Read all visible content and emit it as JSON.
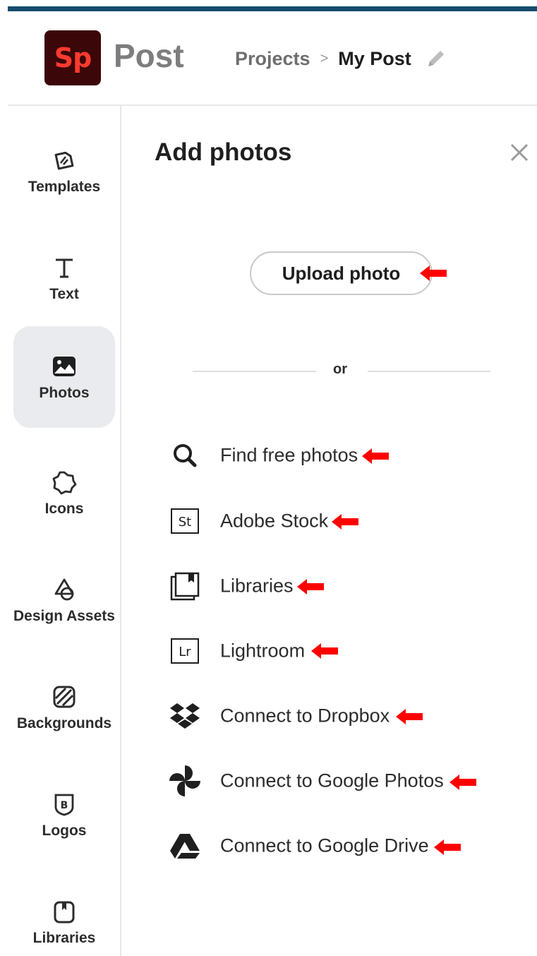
{
  "app": {
    "logo_text": "Sp",
    "name": "Post"
  },
  "breadcrumb": {
    "parent": "Projects",
    "separator": ">",
    "current": "My Post"
  },
  "sidebar": {
    "items": [
      {
        "label": "Templates",
        "icon": "templates-icon"
      },
      {
        "label": "Text",
        "icon": "text-icon"
      },
      {
        "label": "Photos",
        "icon": "photos-icon",
        "active": true
      },
      {
        "label": "Icons",
        "icon": "icons-icon"
      },
      {
        "label": "Design Assets",
        "icon": "design-assets-icon"
      },
      {
        "label": "Backgrounds",
        "icon": "backgrounds-icon"
      },
      {
        "label": "Logos",
        "icon": "logos-icon"
      },
      {
        "label": "Libraries",
        "icon": "libraries-icon"
      }
    ]
  },
  "panel": {
    "title": "Add photos",
    "upload_label": "Upload photo",
    "or_label": "or",
    "sources": [
      {
        "label": "Find free photos",
        "icon": "search-icon"
      },
      {
        "label": "Adobe Stock",
        "icon": "adobe-stock-icon",
        "icon_text": "St"
      },
      {
        "label": "Libraries",
        "icon": "libraries-icon"
      },
      {
        "label": "Lightroom",
        "icon": "lightroom-icon",
        "icon_text": "Lr"
      },
      {
        "label": "Connect to Dropbox",
        "icon": "dropbox-icon"
      },
      {
        "label": "Connect to Google Photos",
        "icon": "google-photos-icon"
      },
      {
        "label": "Connect to Google Drive",
        "icon": "google-drive-icon"
      }
    ]
  },
  "colors": {
    "top_bar": "#164c6e",
    "logo_bg": "#3b0708",
    "logo_fg": "#ff3a2f",
    "active_item_bg": "#e9ebee",
    "annotation_arrow": "#ff0000"
  }
}
